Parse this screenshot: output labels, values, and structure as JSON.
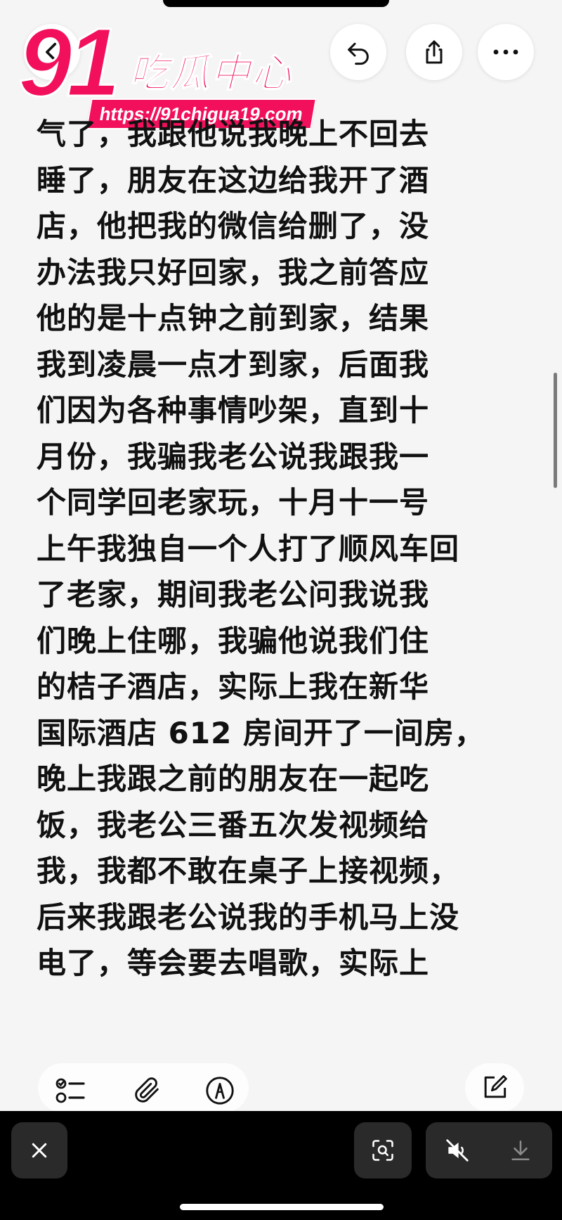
{
  "watermark": {
    "number": "91",
    "name": "吃瓜中心",
    "url": "https://91chigua19.com"
  },
  "icons": {
    "back": "chevron-left-icon",
    "undo": "undo-icon",
    "share": "share-icon",
    "more": "more-icon",
    "checklist": "checklist-icon",
    "attach": "paperclip-icon",
    "markup": "markup-pen-icon",
    "compose": "compose-icon",
    "close": "close-icon",
    "scan": "live-text-scan-icon",
    "mute": "speaker-muted-icon",
    "download": "download-icon"
  },
  "colors": {
    "brand": "#f20f5c",
    "text": "#111111",
    "background": "#f5f5f5"
  },
  "note": {
    "lines": [
      "气了，我跟他说我晚上不回去",
      "睡了，朋友在这边给我开了酒",
      "店，他把我的微信给删了，没",
      "办法我只好回家，我之前答应",
      "他的是十点钟之前到家，结果",
      "我到凌晨一点才到家，后面我",
      "们因为各种事情吵架，直到十",
      "月份，我骗我老公说我跟我一",
      "个同学回老家玩，十月十一号",
      "上午我独自一个人打了顺风车回",
      "了老家，期间我老公问我说我",
      "们晚上住哪，我骗他说我们住",
      "的桔子酒店，实际上我在新华",
      "国际酒店 612 房间开了一间房，",
      "晚上我跟之前的朋友在一起吃",
      "饭，我老公三番五次发视频给",
      "我，我都不敢在桌子上接视频，",
      "后来我跟老公说我的手机马上没",
      "电了，等会要去唱歌，实际上"
    ]
  }
}
